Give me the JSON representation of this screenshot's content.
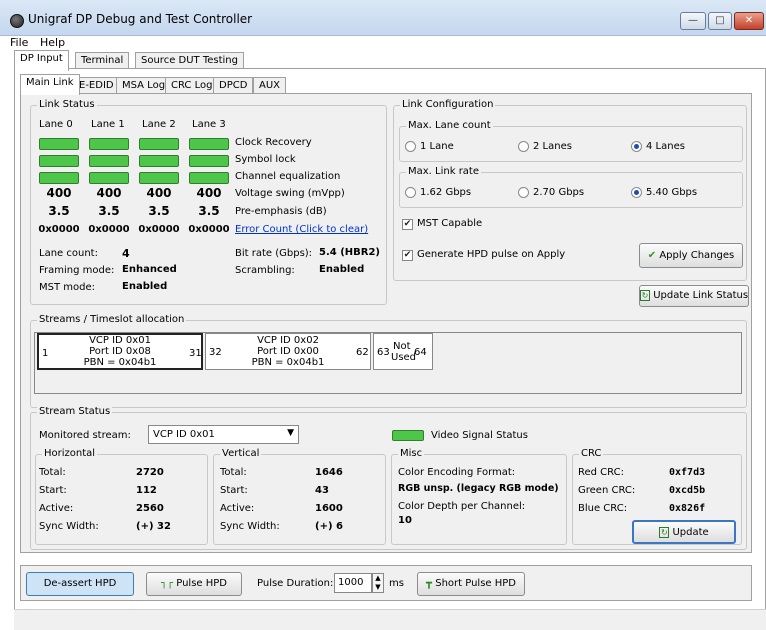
{
  "window": {
    "title": "Unigraf DP Debug and Test Controller",
    "minimize": "—",
    "maximize": "□",
    "close": "✕"
  },
  "menu": {
    "file": "File",
    "help": "Help"
  },
  "top_tabs": [
    "DP Input",
    "Terminal",
    "Source DUT Testing"
  ],
  "sub_tabs": [
    "Main Link",
    "E-EDID",
    "MSA Log",
    "CRC Log",
    "DPCD",
    "AUX"
  ],
  "link_status": {
    "title": "Link Status",
    "lanes": [
      "Lane 0",
      "Lane 1",
      "Lane 2",
      "Lane 3"
    ],
    "row_labels": [
      "Clock Recovery",
      "Symbol lock",
      "Channel equalization",
      "Voltage swing (mVpp)",
      "Pre-emphasis (dB)",
      "Error Count (Click to clear)"
    ],
    "voltage": [
      "400",
      "400",
      "400",
      "400"
    ],
    "preemphasis": [
      "3.5",
      "3.5",
      "3.5",
      "3.5"
    ],
    "errors": [
      "0x0000",
      "0x0000",
      "0x0000",
      "0x0000"
    ],
    "lane_count_label": "Lane count:",
    "lane_count": "4",
    "framing_label": "Framing mode:",
    "framing": "Enhanced",
    "mst_label": "MST mode:",
    "mst": "Enabled",
    "bitrate_label": "Bit rate (Gbps):",
    "bitrate": "5.4 (HBR2)",
    "scrambling_label": "Scrambling:",
    "scrambling": "Enabled"
  },
  "link_config": {
    "title": "Link Configuration",
    "lane_count_title": "Max. Lane count",
    "lane_options": [
      "1 Lane",
      "2 Lanes",
      "4 Lanes"
    ],
    "lane_selected": 2,
    "rate_title": "Max. Link rate",
    "rate_options": [
      "1.62 Gbps",
      "2.70 Gbps",
      "5.40 Gbps"
    ],
    "rate_selected": 2,
    "mst_capable": "MST Capable",
    "hpd_pulse": "Generate HPD pulse on Apply",
    "apply": "Apply Changes",
    "update_status": "Update Link Status"
  },
  "streams": {
    "title": "Streams / Timeslot allocation",
    "slots": [
      {
        "start": "1",
        "end": "31",
        "l1": "VCP ID 0x01",
        "l2": "Port ID 0x08",
        "l3": "PBN = 0x04b1"
      },
      {
        "start": "32",
        "end": "62",
        "l1": "VCP ID 0x02",
        "l2": "Port ID 0x00",
        "l3": "PBN = 0x04b1"
      },
      {
        "start": "63",
        "end": "64",
        "l1": "Not",
        "l2": "Used",
        "l3": ""
      }
    ]
  },
  "stream_status": {
    "title": "Stream Status",
    "monitored_label": "Monitored stream:",
    "monitored_value": "VCP ID 0x01",
    "video_signal": "Video Signal Status",
    "horizontal": {
      "title": "Horizontal",
      "labels": [
        "Total:",
        "Start:",
        "Active:",
        "Sync Width:"
      ],
      "values": [
        "2720",
        "112",
        "2560",
        "(+) 32"
      ]
    },
    "vertical": {
      "title": "Vertical",
      "labels": [
        "Total:",
        "Start:",
        "Active:",
        "Sync Width:"
      ],
      "values": [
        "1646",
        "43",
        "1600",
        "(+) 6"
      ]
    },
    "misc": {
      "title": "Misc",
      "color_enc_label": "Color Encoding Format:",
      "color_enc": "RGB unsp. (legacy RGB mode)",
      "depth_label": "Color Depth per Channel:",
      "depth": "10"
    },
    "crc": {
      "title": "CRC",
      "labels": [
        "Red CRC:",
        "Green CRC:",
        "Blue CRC:"
      ],
      "values": [
        "0xf7d3",
        "0xcd5b",
        "0x826f"
      ],
      "update": "Update"
    }
  },
  "bottom": {
    "deassert": "De-assert HPD",
    "pulse": "Pulse HPD",
    "duration_label": "Pulse Duration:",
    "duration": "1000",
    "unit": "ms",
    "short_pulse": "Short Pulse HPD"
  },
  "colors": {
    "led_green": "#4ec64a",
    "link_blue": "#0033cc",
    "selected_button": "#cfe3f7"
  }
}
